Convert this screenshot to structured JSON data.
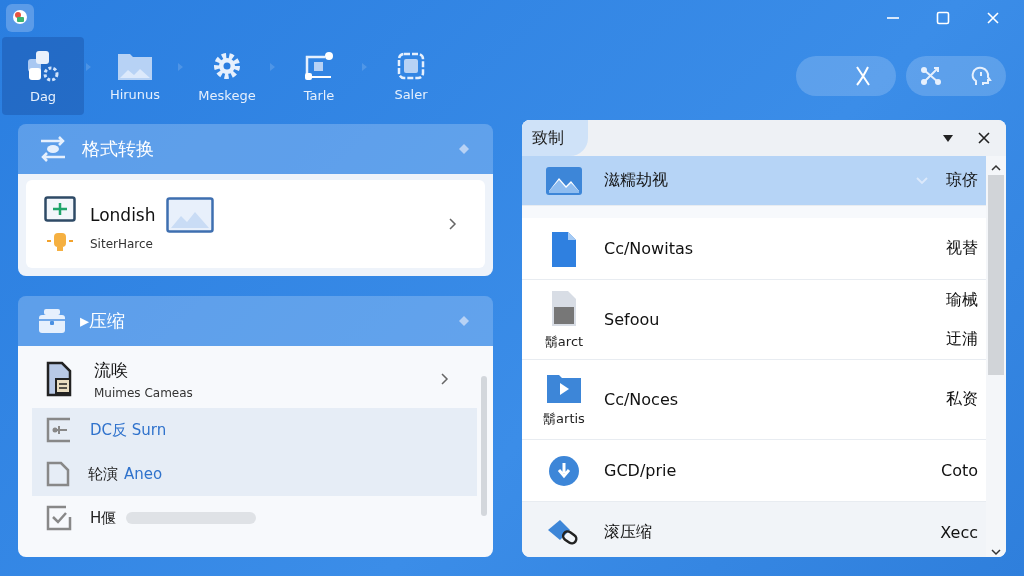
{
  "toolbar": {
    "items": [
      {
        "label": "Dag",
        "selected": true
      },
      {
        "label": "Hirunus",
        "selected": false
      },
      {
        "label": "Meskege",
        "selected": false
      },
      {
        "label": "Tarle",
        "selected": false
      },
      {
        "label": "Saler",
        "selected": false
      }
    ]
  },
  "conversion_card": {
    "title": "格式转换",
    "item": {
      "title": "Londish",
      "subtitle": "SiterHarce"
    }
  },
  "compress_card": {
    "title": "▸压缩",
    "items": [
      {
        "kind": "detail",
        "label": "流唉",
        "subtitle": "Muimes Cameas",
        "selected": false
      },
      {
        "kind": "plain",
        "label": "DC反 Surn",
        "selected": true
      },
      {
        "kind": "plain",
        "label": "轮演",
        "accent": "Aneo",
        "selected": true
      },
      {
        "kind": "bar",
        "label": "H偃",
        "selected": false
      }
    ]
  },
  "file_panel": {
    "tab": "致制",
    "rows": [
      {
        "name": "滋糯劫视",
        "caption": "",
        "right": [
          "琼侪"
        ],
        "selected": true
      },
      {
        "name": "Cc/Nowitas",
        "caption": "",
        "right": [
          "视替"
        ],
        "selected": false
      },
      {
        "name": "Sefoou",
        "caption": "鬍arct",
        "right": [
          "瑜械",
          "迂浦"
        ],
        "selected": false
      },
      {
        "name": "Cc/Noces",
        "caption": "鬍artis",
        "right": [
          "私资"
        ],
        "selected": false
      },
      {
        "name": "GCD/prie",
        "caption": "",
        "right": [
          "Coto"
        ],
        "selected": false
      },
      {
        "name": "滚压缩",
        "caption": "",
        "right": [
          "Xecc"
        ],
        "selected": false
      }
    ]
  }
}
